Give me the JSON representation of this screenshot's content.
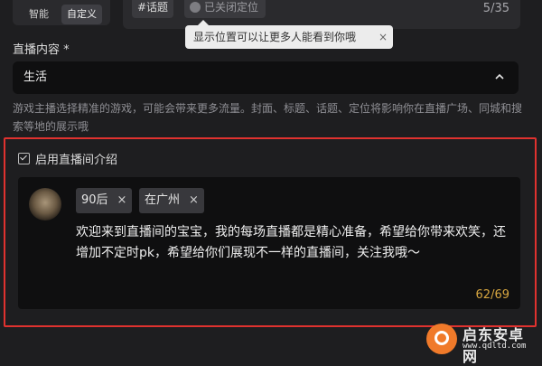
{
  "cover_mode": {
    "options": [
      "智能",
      "自定义"
    ],
    "selected": "自定义"
  },
  "title_field": {
    "topic_chip": "#话题",
    "location_chip": "已关闭定位",
    "count": "5/35"
  },
  "tooltip": {
    "text": "显示位置可以让更多人能看到你哦",
    "close": "×"
  },
  "live_content": {
    "label": "直播内容 *",
    "selected": "生活",
    "helper": "游戏主播选择精准的游戏，可能会带来更多流量。封面、标题、话题、定位将影响你在直播广场、同城和搜索等地的展示哦"
  },
  "intro": {
    "toggle_label": "启用直播间介绍",
    "tags": [
      {
        "label": "90后",
        "remove": "×"
      },
      {
        "label": "在广州",
        "remove": "×"
      }
    ],
    "text": "欢迎来到直播间的宝宝，我的每场直播都是精心准备，希望给你带来欢笑，还增加不定时pk，希望给你们展现不一样的直播间，关注我哦～",
    "count": "62/69"
  },
  "watermark": {
    "brand": "启东安卓网",
    "url": "www.qdltd.com"
  },
  "colors": {
    "highlight_border": "#e0322f",
    "count_accent": "#d8a740"
  }
}
